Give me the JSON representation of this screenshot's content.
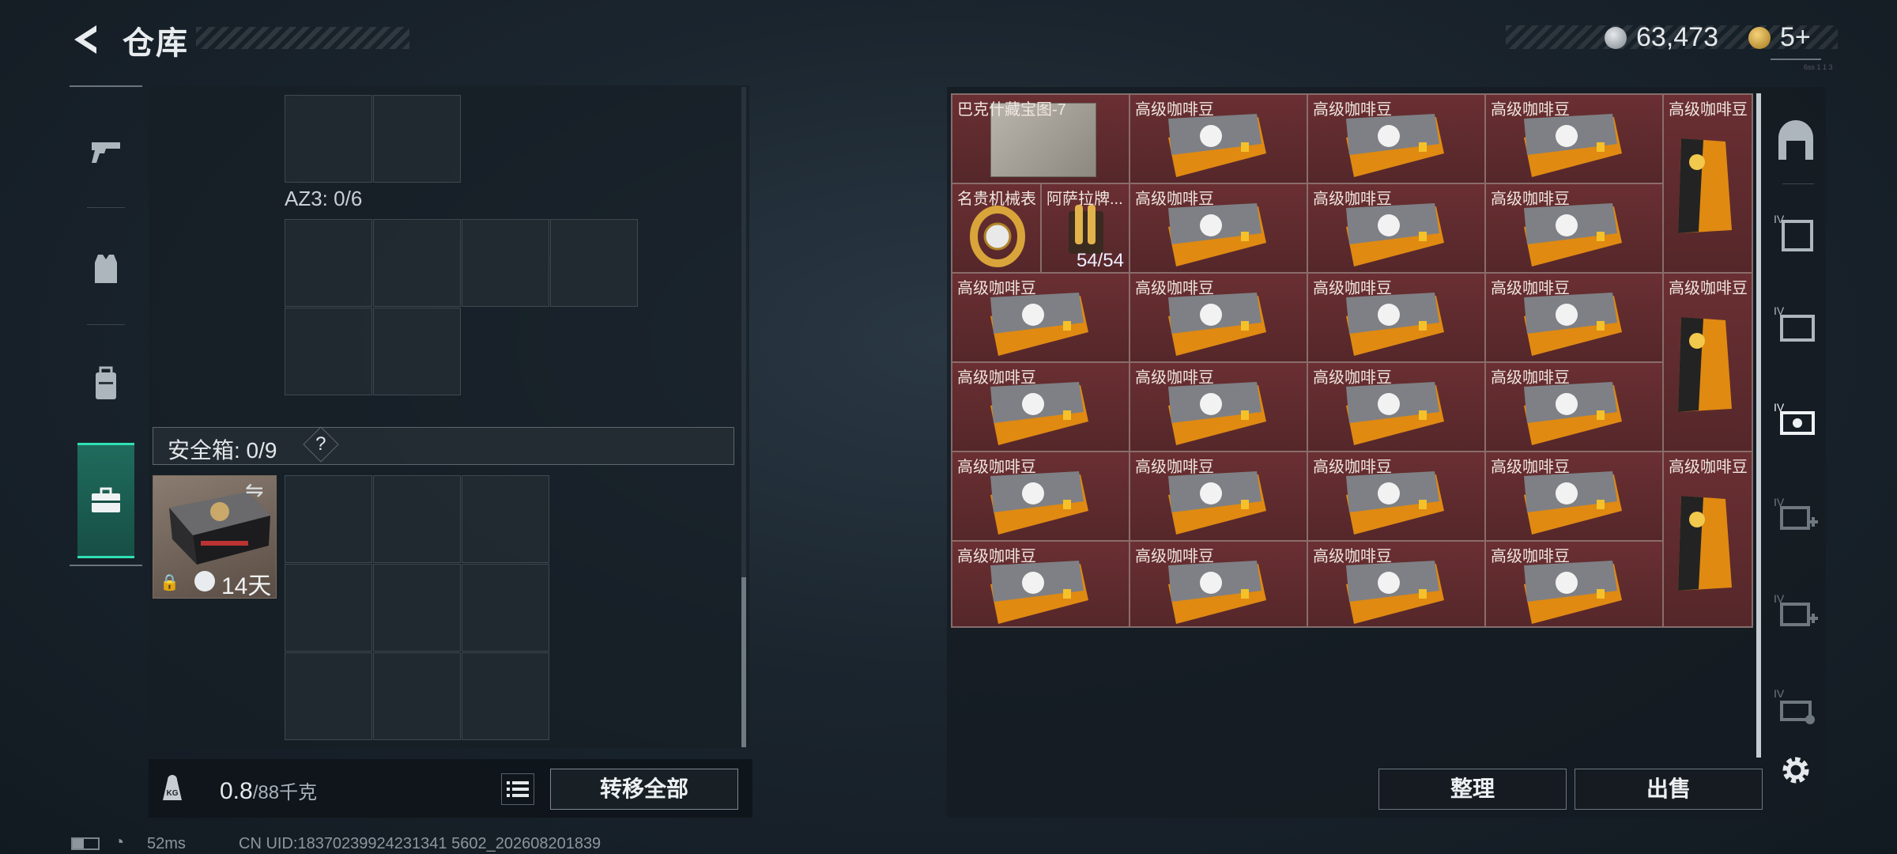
{
  "header": {
    "title": "仓库",
    "currency_silver": "63,473",
    "currency_gold": "5+",
    "tiny_code": "6ss 1 1 3"
  },
  "left": {
    "az_label": "AZ3: 0/6",
    "safe_label": "安全箱: 0/9",
    "safe_help": "?",
    "safebox_days": "14天",
    "weight_value": "0.8",
    "weight_max": "/88千克",
    "transfer_all": "转移全部"
  },
  "status": {
    "ping": "52ms",
    "uid": "CN UID:18370239924231341 5602_202608201839"
  },
  "right": {
    "sort": "整理",
    "sell": "出售",
    "items": {
      "map": "巴克什藏宝图-7",
      "watch": "名贵机械表",
      "ammo": "阿萨拉牌...",
      "ammo_count": "54/54",
      "coffee": "高级咖啡豆"
    }
  }
}
